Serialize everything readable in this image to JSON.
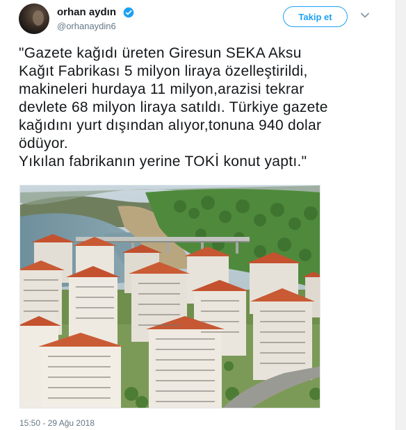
{
  "author": {
    "display_name": "orhan aydın",
    "handle": "@orhanaydin6",
    "verified_icon": "verified-badge-icon",
    "verified_color": "#1da1f2"
  },
  "follow_button": {
    "label": "Takip et"
  },
  "menu": {
    "icon": "chevron-down-icon"
  },
  "tweet": {
    "lines": [
      "\"Gazete kağıdı üreten Giresun SEKA Aksu",
      "Kağıt Fabrikası 5 milyon liraya özelleştirildi,",
      "makineleri hurdaya 11 milyon,arazisi tekrar",
      "devlete 68 milyon liraya satıldı. Türkiye gazete",
      "kağıdını yurt dışından alıyor,tonuna 940 dolar",
      "ödüyor.",
      "Yıkılan fabrikanın yerine TOKİ konut yaptı.\""
    ],
    "timestamp": "15:50 - 29 Ağu 2018"
  },
  "colors": {
    "accent": "#1da1f2",
    "text": "#14171a",
    "muted": "#657786"
  }
}
